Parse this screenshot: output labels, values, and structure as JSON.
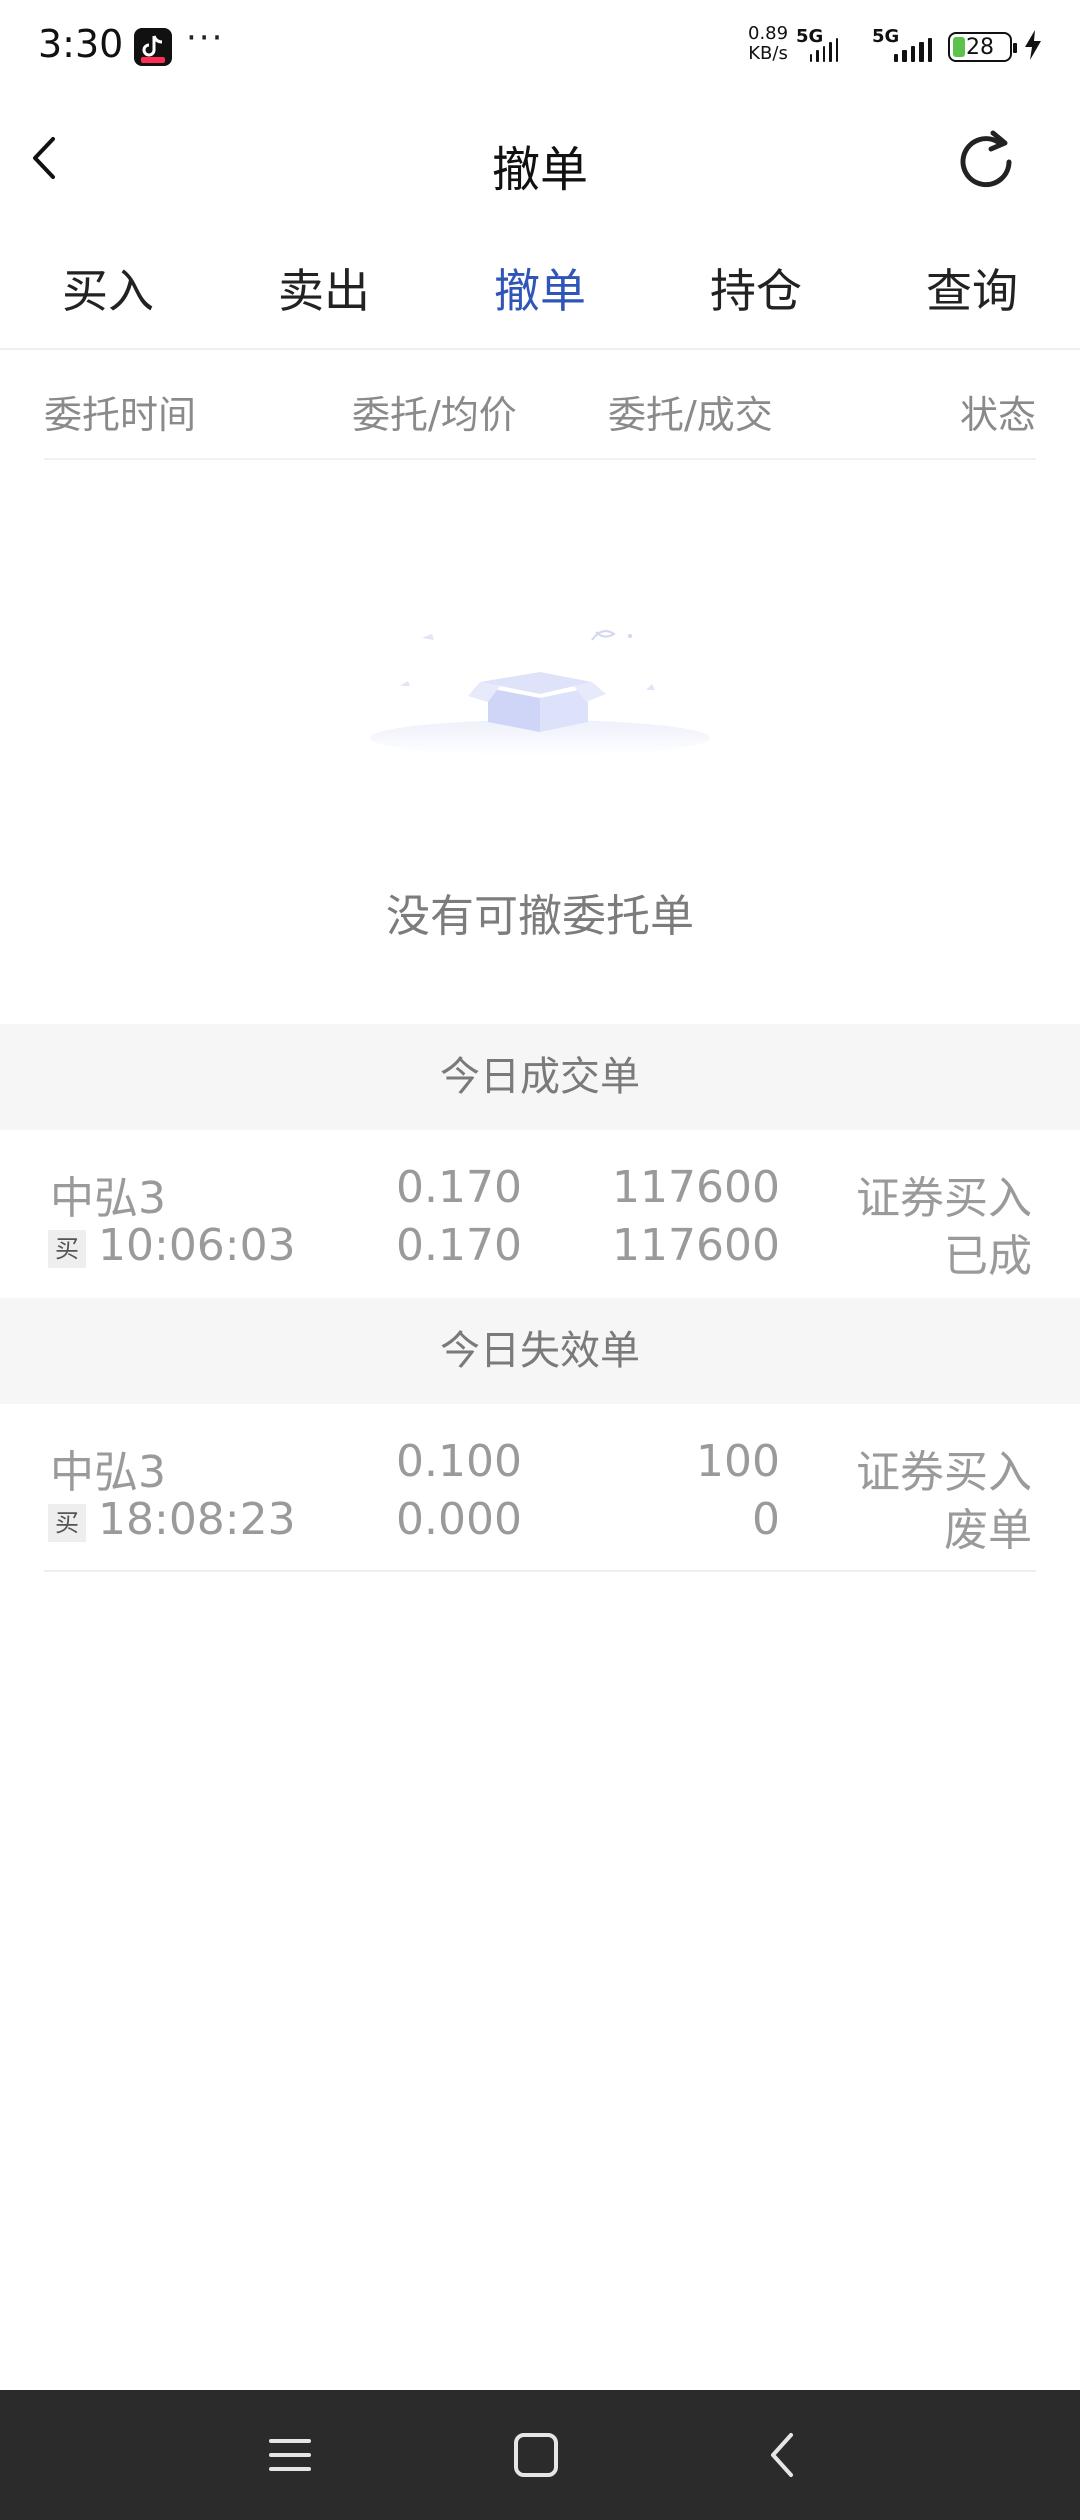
{
  "status_bar": {
    "time": "3:30",
    "dots": "···",
    "net_speed_value": "0.89",
    "net_speed_unit": "KB/s",
    "signal1_label": "5G",
    "signal2_label": "5G",
    "battery": "28",
    "icons": [
      "douyin-app-icon",
      "signal-icon",
      "battery-icon",
      "charging-icon"
    ]
  },
  "header": {
    "title": "撤单",
    "back_icon": "chevron-left-icon",
    "refresh_icon": "refresh-icon"
  },
  "tabs": [
    {
      "label": "买入",
      "active": false
    },
    {
      "label": "卖出",
      "active": false
    },
    {
      "label": "撤单",
      "active": true
    },
    {
      "label": "持仓",
      "active": false
    },
    {
      "label": "查询",
      "active": false
    }
  ],
  "columns": {
    "time": "委托时间",
    "price": "委托/均价",
    "qty": "委托/成交",
    "status": "状态"
  },
  "empty": {
    "text": "没有可撤委托单",
    "icon": "empty-box-illustration"
  },
  "sections": {
    "filled_title": "今日成交单",
    "invalid_title": "今日失效单"
  },
  "filled_orders": [
    {
      "name": "中弘3",
      "side_badge": "买",
      "time": "10:06:03",
      "order_price": "0.170",
      "avg_price": "0.170",
      "order_qty": "117600",
      "filled_qty": "117600",
      "type": "证券买入",
      "status": "已成"
    }
  ],
  "invalid_orders": [
    {
      "name": "中弘3",
      "side_badge": "买",
      "time": "18:08:23",
      "order_price": "0.100",
      "avg_price": "0.000",
      "order_qty": "100",
      "filled_qty": "0",
      "type": "证券买入",
      "status": "废单"
    }
  ],
  "colors": {
    "accent": "#2f55b8",
    "muted_text": "#9a9a9a",
    "section_bg": "#f6f6f6",
    "navbar_bg": "#2b2b2b"
  },
  "navbar": {
    "icons": [
      "menu-icon",
      "home-square-icon",
      "back-triangle-icon"
    ]
  }
}
